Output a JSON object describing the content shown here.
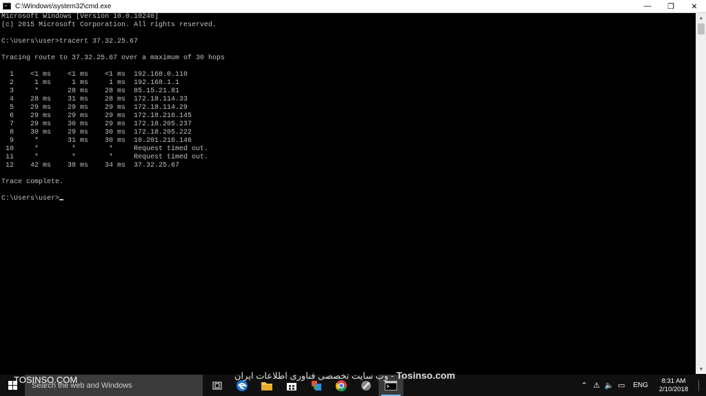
{
  "window": {
    "title": "C:\\Windows\\system32\\cmd.exe",
    "minimize": "—",
    "restore": "❐",
    "close": "✕"
  },
  "console": {
    "text": "Microsoft Windows [Version 10.0.10240]\n(c) 2015 Microsoft Corporation. All rights reserved.\n\nC:\\Users\\user>tracert 37.32.25.67\n\nTracing route to 37.32.25.67 over a maximum of 30 hops\n\n  1    <1 ms    <1 ms    <1 ms  192.168.0.110\n  2     1 ms     1 ms     1 ms  192.168.1.1\n  3     *       28 ms    28 ms  85.15.21.81\n  4    28 ms    31 ms    28 ms  172.18.114.33\n  5    29 ms    29 ms    29 ms  172.18.114.29\n  6    29 ms    29 ms    29 ms  172.18.216.145\n  7    29 ms    30 ms    29 ms  172.18.205.237\n  8    30 ms    29 ms    30 ms  172.18.205.222\n  9     *       31 ms    30 ms  10.201.216.146\n 10     *        *        *     Request timed out.\n 11     *        *        *     Request timed out.\n 12    42 ms    38 ms    34 ms  37.32.25.67\n\nTrace complete.\n\n",
    "prompt": "C:\\Users\\user>"
  },
  "taskbar": {
    "search_placeholder": "Search the web and Windows",
    "watermark_left": "TOSINSO.COM",
    "watermark_center_rtl": "وب سایت تخصصی فناوری اطلاعات ایران - ",
    "watermark_center_brand": "Tosinso.com",
    "language": "ENG",
    "time": "8:31 AM",
    "date": "2/10/2018",
    "icons": [
      "task-view-icon",
      "edge-icon",
      "file-explorer-icon",
      "store-icon",
      "office-icon",
      "chrome-icon",
      "tool-icon",
      "cmd-icon"
    ]
  },
  "colors": {
    "console_bg": "#000000",
    "console_fg": "#c0c0c0",
    "taskbar_bg": "#101010",
    "accent": "#76b9ed"
  }
}
